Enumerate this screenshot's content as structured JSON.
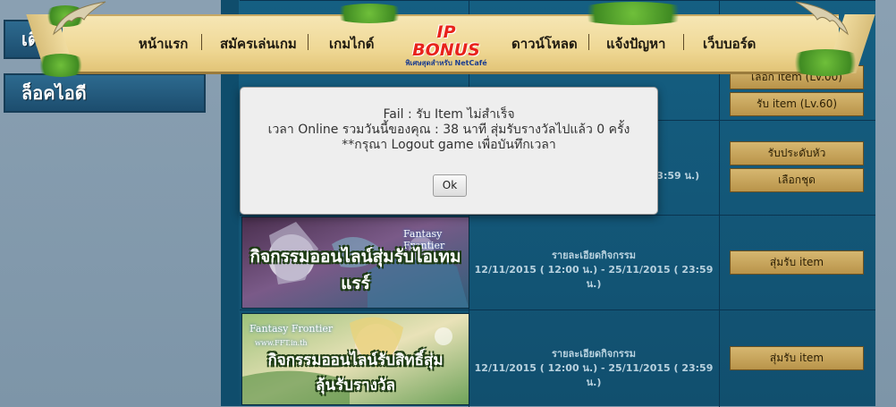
{
  "nav": {
    "items": [
      "หน้าแรก",
      "สมัครเล่นเกม",
      "เกมไกด์",
      "ดาวน์โหลด",
      "แจ้งปัญหา",
      "เว็บบอร์ด"
    ],
    "logo": {
      "title": "IP BONUS",
      "subtitle": "พิเศษสุดสำหรับ NetCafé"
    }
  },
  "left": {
    "btn_top_partial": "เติม",
    "btn_login_id": "ล็อคไอดี"
  },
  "rows": {
    "row1": {
      "partial_button": "เลือก item (Lv.00)",
      "button": "รับ item (Lv.60)"
    },
    "row2": {
      "date_partial": "( 23:59 น.)",
      "button1": "รับประดับหัว",
      "button2": "เลือกชุด"
    },
    "row3": {
      "banner_caption": "กิจกรรมออนไลน์สุ่มรับไอเทมแรร์",
      "banner_logo": "Fantasy Frontier",
      "detail_label": "รายละเอียดกิจกรรม",
      "dates": "12/11/2015 ( 12:00 น.) - 25/11/2015 ( 23:59 น.)",
      "button": "สุ่มรับ item"
    },
    "row4": {
      "banner_caption_line1": "กิจกรรมออนไลน์รับสิทธิ์สุ่ม",
      "banner_caption_line2": "ลุ้นรับรางวัล",
      "banner_logo": "Fantasy Frontier",
      "banner_url": "www.FFT.in.th",
      "detail_label": "รายละเอียดกิจกรรม",
      "dates": "12/11/2015 ( 12:00 น.) - 25/11/2015 ( 23:59 น.)",
      "button": "สุ่มรับ item"
    }
  },
  "dialog": {
    "line1": "Fail : รับ Item ไม่สำเร็จ",
    "line2": "เวลา Online รวมวันนี้ของคุณ : 38 นาที สุ่มรับรางวัลไปแล้ว 0 ครั้ง",
    "line3": "**กรุณา Logout game เพื่อบันทึกเวลา",
    "ok_label": "Ok"
  },
  "colors": {
    "panel": "#155f82",
    "gold_button": "#c9a75c",
    "nav_parchment": "#f2dea3",
    "dialog_bg": "#eeeeee"
  }
}
